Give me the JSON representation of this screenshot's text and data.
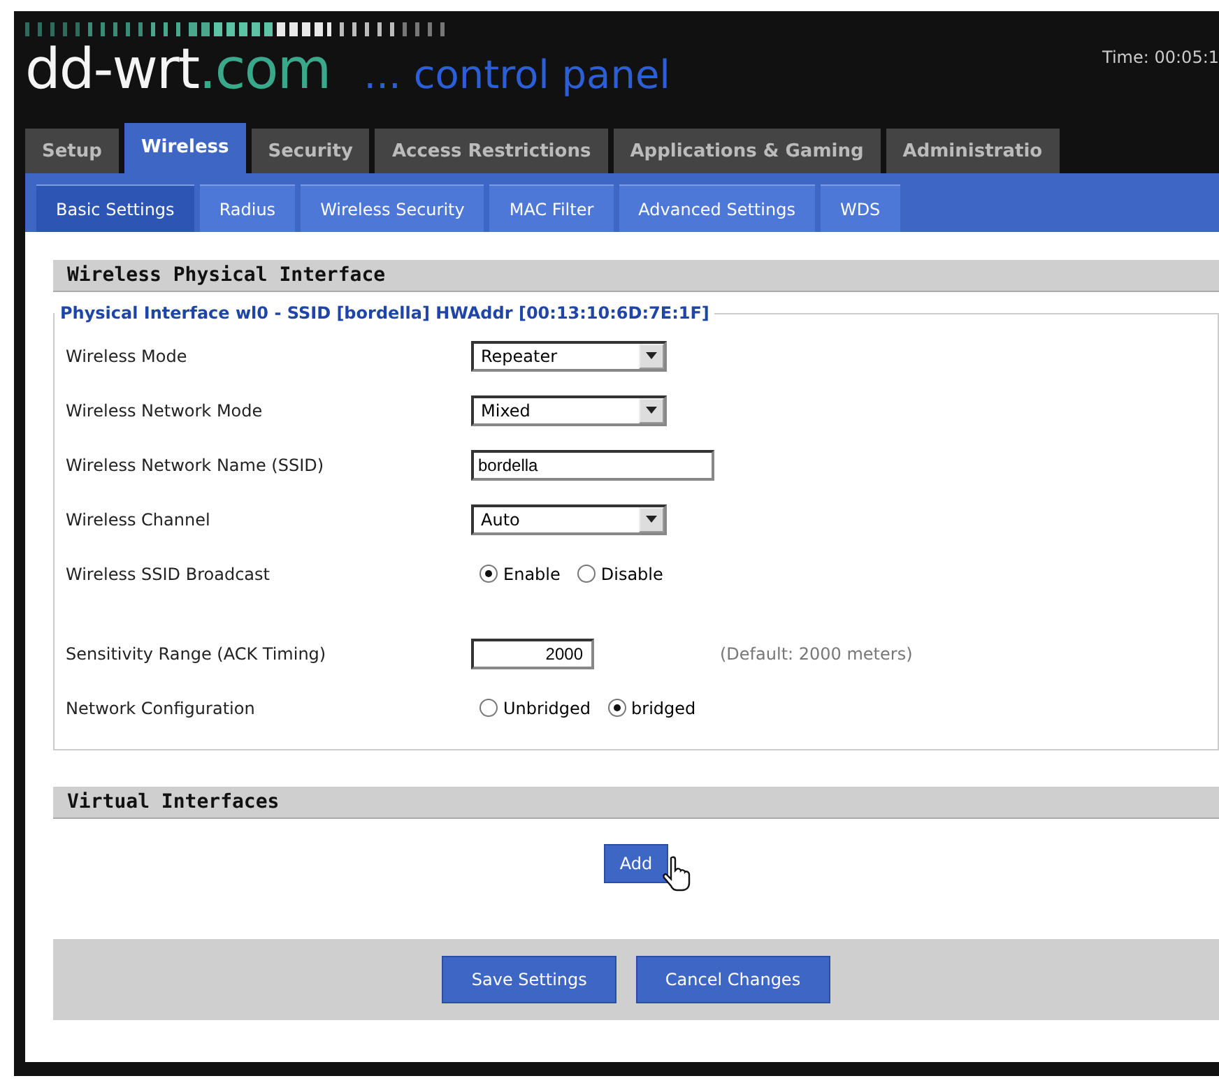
{
  "header": {
    "logo_main": "dd-wrt",
    "logo_suffix": ".com",
    "tagline": "... control panel",
    "time": "Time: 00:05:1"
  },
  "tabs": [
    {
      "label": "Setup",
      "selected": false
    },
    {
      "label": "Wireless",
      "selected": true
    },
    {
      "label": "Security",
      "selected": false
    },
    {
      "label": "Access Restrictions",
      "selected": false
    },
    {
      "label": "Applications & Gaming",
      "selected": false
    },
    {
      "label": "Administratio",
      "selected": false
    }
  ],
  "subtabs": [
    {
      "label": "Basic Settings",
      "selected": true
    },
    {
      "label": "Radius",
      "selected": false
    },
    {
      "label": "Wireless Security",
      "selected": false
    },
    {
      "label": "MAC Filter",
      "selected": false
    },
    {
      "label": "Advanced Settings",
      "selected": false
    },
    {
      "label": "WDS",
      "selected": false
    }
  ],
  "physical_section": {
    "title": "Wireless Physical Interface",
    "legend": "Physical Interface wl0 - SSID [bordella] HWAddr [00:13:10:6D:7E:1F]",
    "field_groups": [
      [
        {
          "kind": "select",
          "label": "Wireless Mode",
          "value": "Repeater"
        },
        {
          "kind": "select",
          "label": "Wireless Network Mode",
          "value": "Mixed"
        },
        {
          "kind": "text",
          "label": "Wireless Network Name (SSID)",
          "value": "bordella"
        },
        {
          "kind": "select",
          "label": "Wireless Channel",
          "value": "Auto"
        },
        {
          "kind": "radio",
          "label": "Wireless SSID Broadcast",
          "options": [
            {
              "label": "Enable",
              "selected": true
            },
            {
              "label": "Disable",
              "selected": false
            }
          ]
        }
      ],
      [
        {
          "kind": "number",
          "label": "Sensitivity Range (ACK Timing)",
          "value": "2000",
          "note": "(Default: 2000 meters)"
        },
        {
          "kind": "radio",
          "label": "Network Configuration",
          "options": [
            {
              "label": "Unbridged",
              "selected": false
            },
            {
              "label": "bridged",
              "selected": true
            }
          ]
        }
      ]
    ]
  },
  "virtual_section": {
    "title": "Virtual Interfaces",
    "add_button": "Add"
  },
  "buttons": [
    "Save Settings",
    "Cancel Changes"
  ]
}
